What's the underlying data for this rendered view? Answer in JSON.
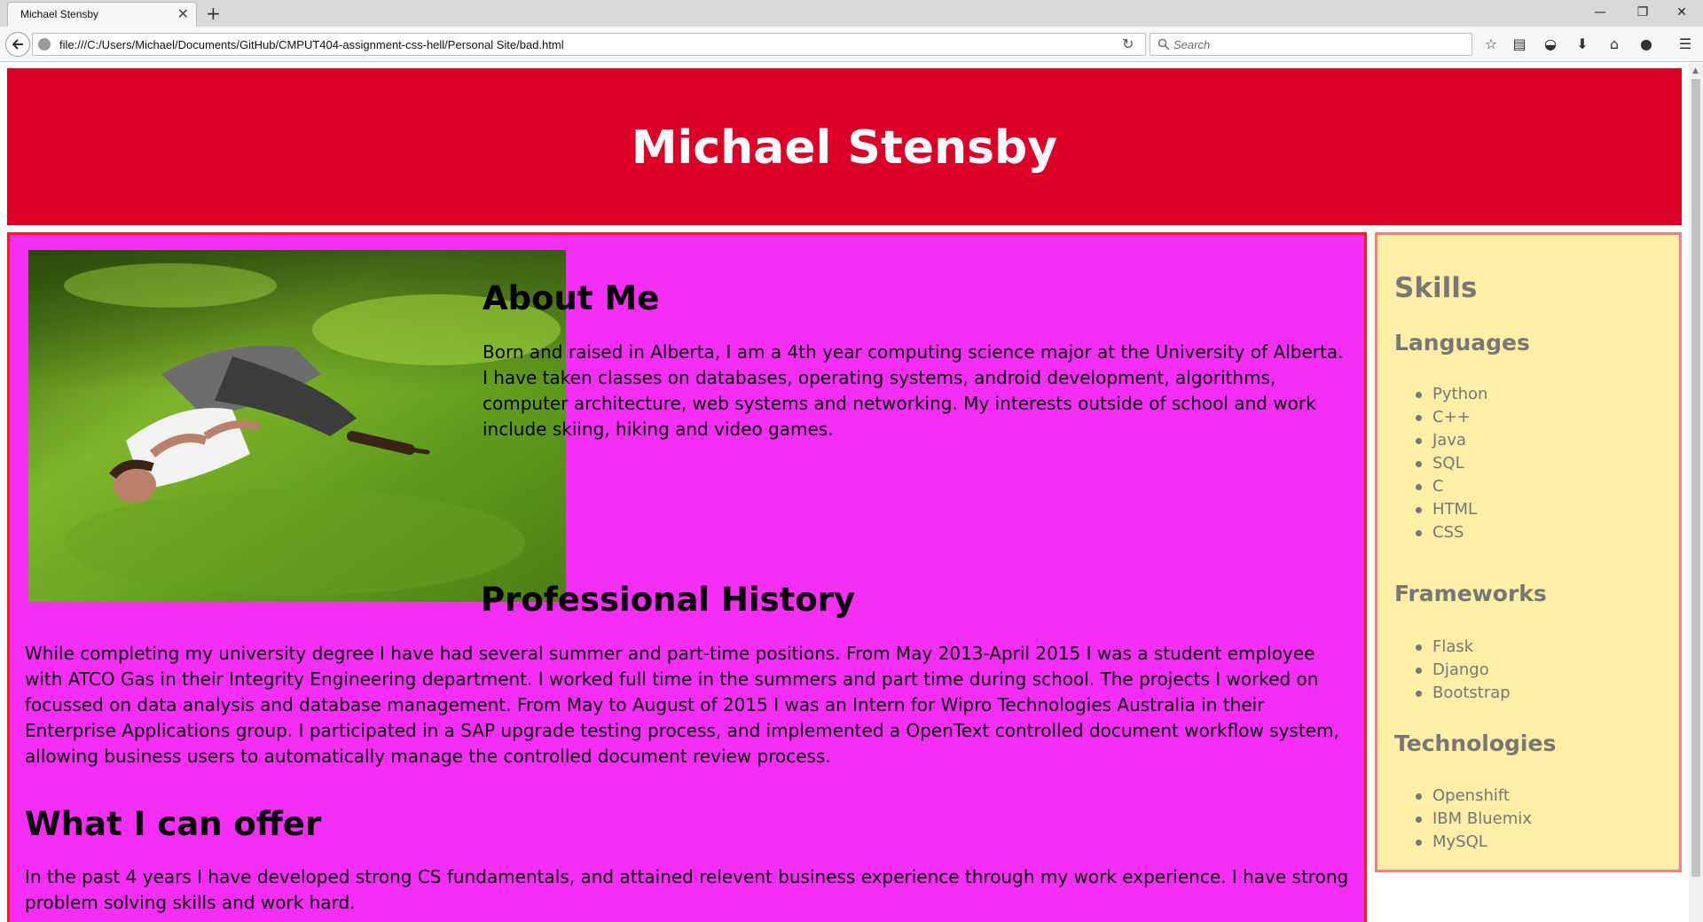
{
  "browser": {
    "tab_title": "Michael Stensby",
    "url": "file:///C:/Users/Michael/Documents/GitHub/CMPUT404-assignment-css-hell/Personal Site/bad.html",
    "search_placeholder": "Search"
  },
  "page": {
    "name": "Michael Stensby",
    "about_heading": "About Me",
    "about_text": "Born and raised in Alberta, I am a 4th year computing science major at the University of Alberta. I have taken classes on databases, operating systems, android development, algorithms, computer architecture, web systems and networking. My interests outside of school and work include skiing, hiking and video games.",
    "history_heading": "Professional History",
    "history_text": "While completing my university degree I have had several summer and part-time positions. From May 2013-April 2015 I was a student employee with ATCO Gas in their Integrity Engineering department. I worked full time in the summers and part time during school. The projects I worked on focussed on data analysis and database management. From May to August of 2015 I was an Intern for Wipro Technologies Australia in their Enterprise Applications group. I participated in a SAP upgrade testing process, and implemented a OpenText controlled document workflow system, allowing business users to automatically manage the controlled document review process.",
    "offer_heading": "What I can offer",
    "offer_text": "In the past 4 years I have developed strong CS fundamentals, and attained relevent business experience through my work experience. I have strong problem solving skills and work hard."
  },
  "sidebar": {
    "title": "Skills",
    "languages_heading": "Languages",
    "languages": [
      "Python",
      "C++",
      "Java",
      "SQL",
      "C",
      "HTML",
      "CSS"
    ],
    "frameworks_heading": "Frameworks",
    "frameworks": [
      "Flask",
      "Django",
      "Bootstrap"
    ],
    "technologies_heading": "Technologies",
    "technologies": [
      "Openshift",
      "IBM Bluemix",
      "MySQL"
    ]
  },
  "colors": {
    "header_bg": "#dc0027",
    "main_bg": "#f52ef5",
    "main_border": "#ff1a1a",
    "sidebar_bg": "#feeea6",
    "sidebar_border": "#f28080",
    "sidebar_text": "#777777"
  }
}
